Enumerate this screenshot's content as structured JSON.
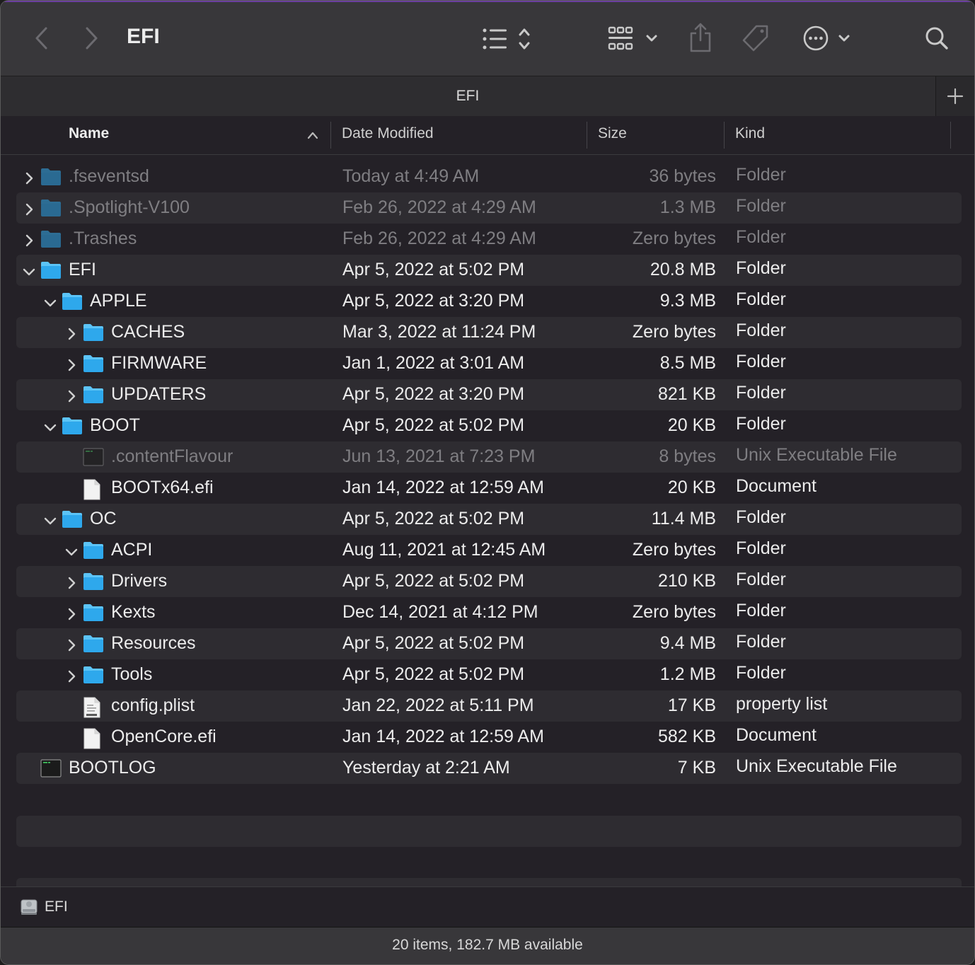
{
  "window": {
    "title": "EFI",
    "tab_label": "EFI",
    "accent_color": "#6b3fa0",
    "folder_color": "#2fa6e6"
  },
  "toolbar": {
    "icons": [
      "back-icon",
      "forward-icon",
      "list-view-icon",
      "group-view-icon",
      "share-icon",
      "tag-icon",
      "more-actions-icon",
      "search-icon"
    ]
  },
  "columns": {
    "name": "Name",
    "date": "Date Modified",
    "size": "Size",
    "kind": "Kind",
    "sort": "ascending"
  },
  "rows": [
    {
      "name": ".fseventsd",
      "date": "Today at 4:49 AM",
      "size": "36 bytes",
      "kind": "Folder",
      "depth": 0,
      "icon": "folder",
      "disc": "closed",
      "dim": true
    },
    {
      "name": ".Spotlight-V100",
      "date": "Feb 26, 2022 at 4:29 AM",
      "size": "1.3 MB",
      "kind": "Folder",
      "depth": 0,
      "icon": "folder",
      "disc": "closed",
      "dim": true
    },
    {
      "name": ".Trashes",
      "date": "Feb 26, 2022 at 4:29 AM",
      "size": "Zero bytes",
      "kind": "Folder",
      "depth": 0,
      "icon": "folder",
      "disc": "closed",
      "dim": true
    },
    {
      "name": "EFI",
      "date": "Apr 5, 2022 at 5:02 PM",
      "size": "20.8 MB",
      "kind": "Folder",
      "depth": 0,
      "icon": "folder",
      "disc": "open",
      "dim": false
    },
    {
      "name": "APPLE",
      "date": "Apr 5, 2022 at 3:20 PM",
      "size": "9.3 MB",
      "kind": "Folder",
      "depth": 1,
      "icon": "folder",
      "disc": "open",
      "dim": false
    },
    {
      "name": "CACHES",
      "date": "Mar 3, 2022 at 11:24 PM",
      "size": "Zero bytes",
      "kind": "Folder",
      "depth": 2,
      "icon": "folder",
      "disc": "closed",
      "dim": false
    },
    {
      "name": "FIRMWARE",
      "date": "Jan 1, 2022 at 3:01 AM",
      "size": "8.5 MB",
      "kind": "Folder",
      "depth": 2,
      "icon": "folder",
      "disc": "closed",
      "dim": false
    },
    {
      "name": "UPDATERS",
      "date": "Apr 5, 2022 at 3:20 PM",
      "size": "821 KB",
      "kind": "Folder",
      "depth": 2,
      "icon": "folder",
      "disc": "closed",
      "dim": false
    },
    {
      "name": "BOOT",
      "date": "Apr 5, 2022 at 5:02 PM",
      "size": "20 KB",
      "kind": "Folder",
      "depth": 1,
      "icon": "folder",
      "disc": "open",
      "dim": false
    },
    {
      "name": ".contentFlavour",
      "date": "Jun 13, 2021 at 7:23 PM",
      "size": "8 bytes",
      "kind": "Unix Executable File",
      "depth": 2,
      "icon": "exec",
      "disc": "none",
      "dim": true
    },
    {
      "name": "BOOTx64.efi",
      "date": "Jan 14, 2022 at 12:59 AM",
      "size": "20 KB",
      "kind": "Document",
      "depth": 2,
      "icon": "doc",
      "disc": "none",
      "dim": false
    },
    {
      "name": "OC",
      "date": "Apr 5, 2022 at 5:02 PM",
      "size": "11.4 MB",
      "kind": "Folder",
      "depth": 1,
      "icon": "folder",
      "disc": "open",
      "dim": false
    },
    {
      "name": "ACPI",
      "date": "Aug 11, 2021 at 12:45 AM",
      "size": "Zero bytes",
      "kind": "Folder",
      "depth": 2,
      "icon": "folder",
      "disc": "open",
      "dim": false
    },
    {
      "name": "Drivers",
      "date": "Apr 5, 2022 at 5:02 PM",
      "size": "210 KB",
      "kind": "Folder",
      "depth": 2,
      "icon": "folder",
      "disc": "closed",
      "dim": false
    },
    {
      "name": "Kexts",
      "date": "Dec 14, 2021 at 4:12 PM",
      "size": "Zero bytes",
      "kind": "Folder",
      "depth": 2,
      "icon": "folder",
      "disc": "closed",
      "dim": false
    },
    {
      "name": "Resources",
      "date": "Apr 5, 2022 at 5:02 PM",
      "size": "9.4 MB",
      "kind": "Folder",
      "depth": 2,
      "icon": "folder",
      "disc": "closed",
      "dim": false
    },
    {
      "name": "Tools",
      "date": "Apr 5, 2022 at 5:02 PM",
      "size": "1.2 MB",
      "kind": "Folder",
      "depth": 2,
      "icon": "folder",
      "disc": "closed",
      "dim": false
    },
    {
      "name": "config.plist",
      "date": "Jan 22, 2022 at 5:11 PM",
      "size": "17 KB",
      "kind": "property list",
      "depth": 2,
      "icon": "plist",
      "disc": "none",
      "dim": false
    },
    {
      "name": "OpenCore.efi",
      "date": "Jan 14, 2022 at 12:59 AM",
      "size": "582 KB",
      "kind": "Document",
      "depth": 2,
      "icon": "doc",
      "disc": "none",
      "dim": false
    },
    {
      "name": "BOOTLOG",
      "date": "Yesterday at 2:21 AM",
      "size": "7 KB",
      "kind": "Unix Executable File",
      "depth": 0,
      "icon": "exec",
      "disc": "none",
      "dim": false
    }
  ],
  "pathbar": {
    "label": "EFI",
    "icon": "disk-icon"
  },
  "status": {
    "text": "20 items, 182.7 MB available"
  }
}
